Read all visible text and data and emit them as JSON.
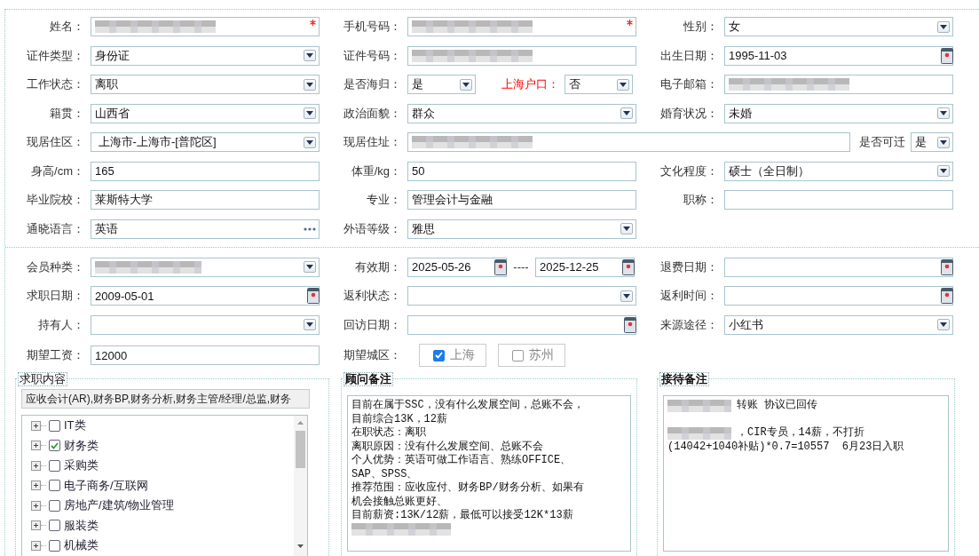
{
  "sections": [
    {
      "rows": [
        [
          {
            "label": "姓名：",
            "kind": "text",
            "redacted": true,
            "required": true
          },
          {
            "label": "手机号码：",
            "kind": "text",
            "redacted": true,
            "required": true
          },
          {
            "label": "性别：",
            "kind": "select",
            "value": "女"
          }
        ],
        [
          {
            "label": "证件类型：",
            "kind": "select",
            "value": "身份证"
          },
          {
            "label": "证件号码：",
            "kind": "text",
            "redacted": true
          },
          {
            "label": "出生日期：",
            "kind": "date",
            "value": "1995-11-03"
          }
        ],
        [
          {
            "label": "工作状态：",
            "kind": "select",
            "value": "离职"
          },
          {
            "label": "是否海归：",
            "kind": "select",
            "value": "是",
            "extra": {
              "label": "上海户口：",
              "highlighted": true,
              "kind": "select",
              "value": "否"
            }
          },
          {
            "label": "电子邮箱：",
            "kind": "text",
            "redacted": true
          }
        ],
        [
          {
            "label": "籍贯：",
            "kind": "select",
            "value": "山西省"
          },
          {
            "label": "政治面貌：",
            "kind": "select",
            "value": "群众"
          },
          {
            "label": "婚育状况：",
            "kind": "select",
            "value": "未婚"
          }
        ],
        [
          {
            "label": "现居住区：",
            "kind": "select",
            "value": " 上海市-上海市-[普陀区]"
          },
          {
            "label": "现居住址：",
            "kind": "text",
            "redacted": true,
            "extra": {
              "label": "是否可迁",
              "highlighted": false,
              "kind": "select",
              "value": "是"
            }
          }
        ],
        [
          {
            "label": "身高/cm：",
            "kind": "text",
            "value": "165"
          },
          {
            "label": "体重/kg：",
            "kind": "text",
            "value": "50"
          },
          {
            "label": "文化程度：",
            "kind": "select",
            "value": "硕士（全日制）"
          }
        ],
        [
          {
            "label": "毕业院校：",
            "kind": "text",
            "value": "莱斯特大学"
          },
          {
            "label": "专业：",
            "kind": "text",
            "value": "管理会计与金融"
          },
          {
            "label": "职称：",
            "kind": "text"
          }
        ],
        [
          {
            "label": "通晓语言：",
            "kind": "picker",
            "value": "英语"
          },
          {
            "label": "外语等级：",
            "kind": "select",
            "value": "雅思"
          }
        ]
      ]
    },
    {
      "rows": [
        [
          {
            "label": "会员种类：",
            "kind": "select",
            "redacted": true
          },
          {
            "label": "有效期：",
            "kind": "date_range",
            "values": [
              "2025-05-26",
              "2025-12-25"
            ],
            "separator": "----"
          },
          {
            "label": "退费日期：",
            "kind": "date"
          }
        ],
        [
          {
            "label": "求职日期：",
            "kind": "date",
            "value": "2009-05-01"
          },
          {
            "label": "返利状态：",
            "kind": "select"
          },
          {
            "label": "返利时间：",
            "kind": "date"
          }
        ],
        [
          {
            "label": "持有人：",
            "kind": "select"
          },
          {
            "label": "回访日期：",
            "kind": "date"
          },
          {
            "label": "来源途径：",
            "kind": "select",
            "value": "小红书"
          }
        ],
        [
          {
            "label": "期望工资：",
            "kind": "text",
            "value": "12000"
          },
          {
            "label": "期望城区：",
            "kind": "checkgroup",
            "options": [
              {
                "label": "上海",
                "checked": true
              },
              {
                "label": "苏州",
                "checked": false
              }
            ]
          }
        ]
      ]
    }
  ],
  "job_content": {
    "title": "求职内容",
    "summary": "应收会计(AR),财务BP,财务分析,财务主管/经理/总监,财务",
    "tree": [
      {
        "label": "IT类",
        "checked": false,
        "expanded": false
      },
      {
        "label": "财务类",
        "checked": true,
        "expanded": false
      },
      {
        "label": "采购类",
        "checked": false,
        "expanded": false
      },
      {
        "label": "电子商务/互联网",
        "checked": false,
        "expanded": false
      },
      {
        "label": "房地产/建筑/物业管理",
        "checked": false,
        "expanded": false
      },
      {
        "label": "服装类",
        "checked": false,
        "expanded": false
      },
      {
        "label": "机械类",
        "checked": false,
        "expanded": false
      }
    ]
  },
  "notes": [
    {
      "title": "顾问备注",
      "lines": [
        {
          "kind": "text",
          "text": "目前在属于SSC，没有什么发展空间，总账不会，"
        },
        {
          "kind": "text",
          "text": "目前综合13K，12薪"
        },
        {
          "kind": "text",
          "text": "在职状态：离职"
        },
        {
          "kind": "text",
          "text": "离职原因：没有什么发展空间、总账不会"
        },
        {
          "kind": "text",
          "text": "个人优势：英语可做工作语言、熟练OFFICE、"
        },
        {
          "kind": "text",
          "text": "SAP、SPSS、"
        },
        {
          "kind": "text",
          "text": "推荐范围：应收应付、财务BP/财务分析、如果有"
        },
        {
          "kind": "text",
          "text": "机会接触总账更好、"
        },
        {
          "kind": "text",
          "text": "目前薪资:13K/12薪，最低可以接受12K*13薪"
        },
        {
          "kind": "redacted"
        }
      ]
    },
    {
      "title": "接待备注",
      "lines": [
        {
          "kind": "text",
          "redacted_prefix": true,
          "text": "转账 协议已回传"
        },
        {
          "kind": "blank"
        },
        {
          "kind": "text",
          "redacted_prefix": true,
          "text": "，CIR专员，14薪，不打折"
        },
        {
          "kind": "text",
          "text": "(14042+1040补贴)*0.7=10557  6月23日入职"
        }
      ]
    }
  ]
}
